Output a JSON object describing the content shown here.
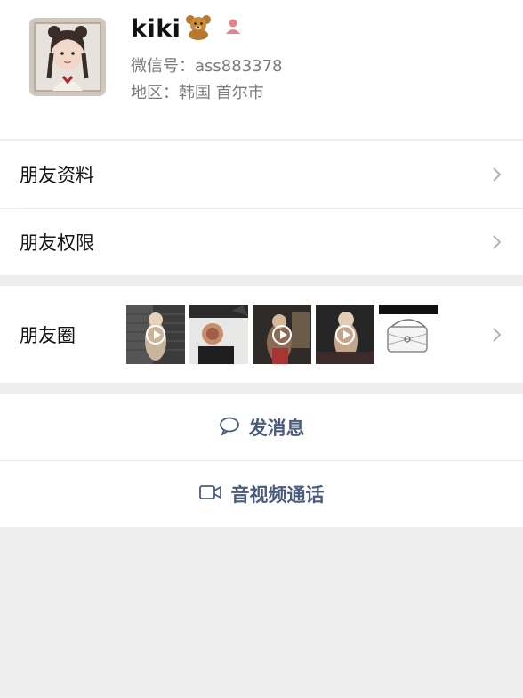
{
  "profile": {
    "name": "kiki",
    "wechat_id": "微信号：ass883378",
    "region": "地区：韩国 首尔市"
  },
  "rows": {
    "friend_info": "朋友资料",
    "friend_permissions": "朋友权限",
    "moments": "朋友圈"
  },
  "actions": {
    "send_message": "发消息",
    "av_call": "音视频通话"
  },
  "icons": {
    "bear": "bear-emoji-icon",
    "gender": "female-gender-icon",
    "chevron": "chevron-right-icon",
    "message": "chat-bubble-icon",
    "video": "video-camera-icon",
    "play": "play-icon"
  },
  "colors": {
    "action_text": "#4b5b7d",
    "background": "#ededed",
    "gender": "#e8818b"
  }
}
